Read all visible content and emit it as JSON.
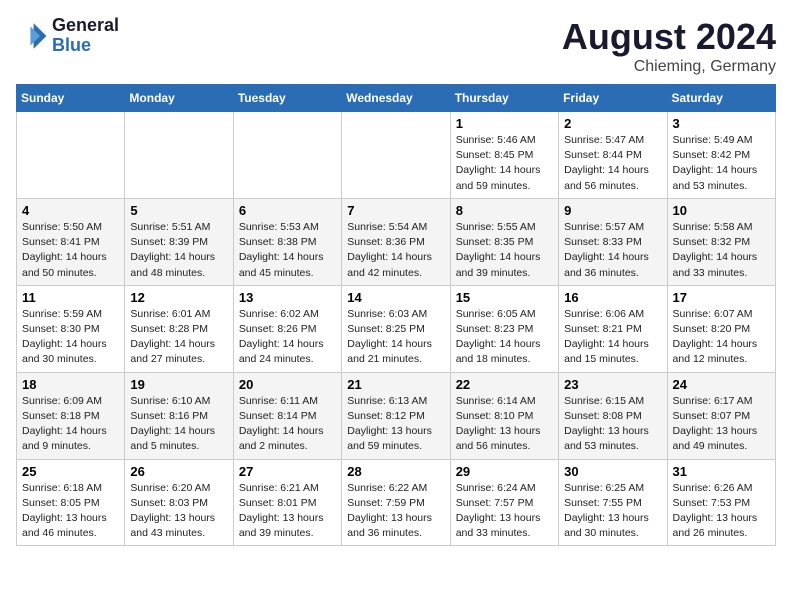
{
  "header": {
    "logo_general": "General",
    "logo_blue": "Blue",
    "title": "August 2024",
    "location": "Chieming, Germany"
  },
  "weekdays": [
    "Sunday",
    "Monday",
    "Tuesday",
    "Wednesday",
    "Thursday",
    "Friday",
    "Saturday"
  ],
  "weeks": [
    [
      {
        "day": "",
        "info": ""
      },
      {
        "day": "",
        "info": ""
      },
      {
        "day": "",
        "info": ""
      },
      {
        "day": "",
        "info": ""
      },
      {
        "day": "1",
        "info": "Sunrise: 5:46 AM\nSunset: 8:45 PM\nDaylight: 14 hours\nand 59 minutes."
      },
      {
        "day": "2",
        "info": "Sunrise: 5:47 AM\nSunset: 8:44 PM\nDaylight: 14 hours\nand 56 minutes."
      },
      {
        "day": "3",
        "info": "Sunrise: 5:49 AM\nSunset: 8:42 PM\nDaylight: 14 hours\nand 53 minutes."
      }
    ],
    [
      {
        "day": "4",
        "info": "Sunrise: 5:50 AM\nSunset: 8:41 PM\nDaylight: 14 hours\nand 50 minutes."
      },
      {
        "day": "5",
        "info": "Sunrise: 5:51 AM\nSunset: 8:39 PM\nDaylight: 14 hours\nand 48 minutes."
      },
      {
        "day": "6",
        "info": "Sunrise: 5:53 AM\nSunset: 8:38 PM\nDaylight: 14 hours\nand 45 minutes."
      },
      {
        "day": "7",
        "info": "Sunrise: 5:54 AM\nSunset: 8:36 PM\nDaylight: 14 hours\nand 42 minutes."
      },
      {
        "day": "8",
        "info": "Sunrise: 5:55 AM\nSunset: 8:35 PM\nDaylight: 14 hours\nand 39 minutes."
      },
      {
        "day": "9",
        "info": "Sunrise: 5:57 AM\nSunset: 8:33 PM\nDaylight: 14 hours\nand 36 minutes."
      },
      {
        "day": "10",
        "info": "Sunrise: 5:58 AM\nSunset: 8:32 PM\nDaylight: 14 hours\nand 33 minutes."
      }
    ],
    [
      {
        "day": "11",
        "info": "Sunrise: 5:59 AM\nSunset: 8:30 PM\nDaylight: 14 hours\nand 30 minutes."
      },
      {
        "day": "12",
        "info": "Sunrise: 6:01 AM\nSunset: 8:28 PM\nDaylight: 14 hours\nand 27 minutes."
      },
      {
        "day": "13",
        "info": "Sunrise: 6:02 AM\nSunset: 8:26 PM\nDaylight: 14 hours\nand 24 minutes."
      },
      {
        "day": "14",
        "info": "Sunrise: 6:03 AM\nSunset: 8:25 PM\nDaylight: 14 hours\nand 21 minutes."
      },
      {
        "day": "15",
        "info": "Sunrise: 6:05 AM\nSunset: 8:23 PM\nDaylight: 14 hours\nand 18 minutes."
      },
      {
        "day": "16",
        "info": "Sunrise: 6:06 AM\nSunset: 8:21 PM\nDaylight: 14 hours\nand 15 minutes."
      },
      {
        "day": "17",
        "info": "Sunrise: 6:07 AM\nSunset: 8:20 PM\nDaylight: 14 hours\nand 12 minutes."
      }
    ],
    [
      {
        "day": "18",
        "info": "Sunrise: 6:09 AM\nSunset: 8:18 PM\nDaylight: 14 hours\nand 9 minutes."
      },
      {
        "day": "19",
        "info": "Sunrise: 6:10 AM\nSunset: 8:16 PM\nDaylight: 14 hours\nand 5 minutes."
      },
      {
        "day": "20",
        "info": "Sunrise: 6:11 AM\nSunset: 8:14 PM\nDaylight: 14 hours\nand 2 minutes."
      },
      {
        "day": "21",
        "info": "Sunrise: 6:13 AM\nSunset: 8:12 PM\nDaylight: 13 hours\nand 59 minutes."
      },
      {
        "day": "22",
        "info": "Sunrise: 6:14 AM\nSunset: 8:10 PM\nDaylight: 13 hours\nand 56 minutes."
      },
      {
        "day": "23",
        "info": "Sunrise: 6:15 AM\nSunset: 8:08 PM\nDaylight: 13 hours\nand 53 minutes."
      },
      {
        "day": "24",
        "info": "Sunrise: 6:17 AM\nSunset: 8:07 PM\nDaylight: 13 hours\nand 49 minutes."
      }
    ],
    [
      {
        "day": "25",
        "info": "Sunrise: 6:18 AM\nSunset: 8:05 PM\nDaylight: 13 hours\nand 46 minutes."
      },
      {
        "day": "26",
        "info": "Sunrise: 6:20 AM\nSunset: 8:03 PM\nDaylight: 13 hours\nand 43 minutes."
      },
      {
        "day": "27",
        "info": "Sunrise: 6:21 AM\nSunset: 8:01 PM\nDaylight: 13 hours\nand 39 minutes."
      },
      {
        "day": "28",
        "info": "Sunrise: 6:22 AM\nSunset: 7:59 PM\nDaylight: 13 hours\nand 36 minutes."
      },
      {
        "day": "29",
        "info": "Sunrise: 6:24 AM\nSunset: 7:57 PM\nDaylight: 13 hours\nand 33 minutes."
      },
      {
        "day": "30",
        "info": "Sunrise: 6:25 AM\nSunset: 7:55 PM\nDaylight: 13 hours\nand 30 minutes."
      },
      {
        "day": "31",
        "info": "Sunrise: 6:26 AM\nSunset: 7:53 PM\nDaylight: 13 hours\nand 26 minutes."
      }
    ]
  ]
}
